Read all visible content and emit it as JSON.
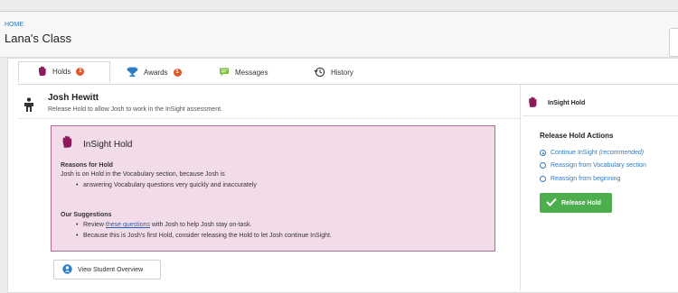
{
  "header": {
    "breadcrumb": "HOME",
    "title": "Lana's Class"
  },
  "tabs": [
    {
      "label": "Holds",
      "badge": "1",
      "icon": "hand-icon",
      "active": true
    },
    {
      "label": "Awards",
      "badge": "1",
      "icon": "trophy-icon",
      "active": false
    },
    {
      "label": "Messages",
      "icon": "message-icon",
      "active": false
    },
    {
      "label": "History",
      "icon": "history-icon",
      "active": false
    }
  ],
  "student": {
    "name": "Josh Hewitt",
    "description": "Release Hold to allow Josh to work in the InSight assessment."
  },
  "hold_box": {
    "title": "InSight Hold",
    "reasons_heading": "Reasons for Hold",
    "reasons_text": "Josh is on Hold in the Vocabulary section, because Josh is",
    "reasons_bullets": [
      "answering Vocabulary questions very quickly and inaccurately"
    ],
    "suggestions_heading": "Our Suggestions",
    "suggestion_1_prefix": "Review ",
    "suggestion_1_link": "these questions",
    "suggestion_1_suffix": " with Josh to help Josh stay on-task.",
    "suggestion_2": "Because this is Josh's first Hold, consider releasing the Hold to let Josh continue InSight."
  },
  "overview_button": "View Student Overview",
  "side": {
    "hold_title": "InSight Hold",
    "actions_title": "Release Hold Actions",
    "options": [
      {
        "label": "Continue InSight ",
        "note": "(recommended)",
        "selected": true
      },
      {
        "label": "Reassign from Vocabulary section",
        "selected": false
      },
      {
        "label": "Reassign from beginning",
        "selected": false
      }
    ],
    "release_button": "Release Hold"
  },
  "colors": {
    "accent": "#2d7bc4",
    "hold_box_bg": "#f2dcea",
    "hold_box_border": "#b06a98",
    "hand_icon": "#8b1a5c",
    "badge": "#e0572a",
    "trophy": "#2d7bc4",
    "message": "#7cbf3a",
    "release": "#4cae4c"
  }
}
